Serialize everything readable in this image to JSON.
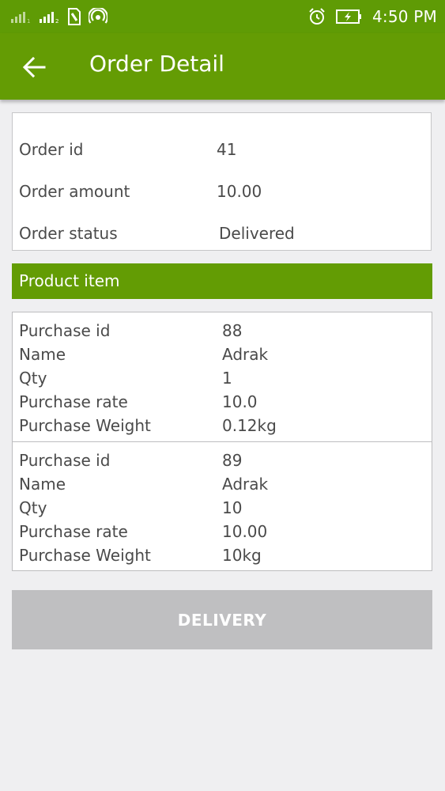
{
  "status_bar": {
    "time": "4:50 PM",
    "icons": [
      "signal-icon",
      "signal-icon-2",
      "sim-icon",
      "hotspot-icon",
      "alarm-icon",
      "battery-charging-icon"
    ]
  },
  "app_bar": {
    "title": "Order Detail",
    "back_icon": "arrow-left-icon"
  },
  "order": {
    "id_label": "Order id",
    "id_value": "41",
    "amount_label": "Order amount",
    "amount_value": "10.00",
    "status_label": "Order status",
    "status_value": "Delivered"
  },
  "products_header": "Product item",
  "products": [
    {
      "rows": [
        {
          "label": "Purchase id",
          "value": "88"
        },
        {
          "label": "Name",
          "value": "Adrak"
        },
        {
          "label": "Qty",
          "value": "1"
        },
        {
          "label": "Purchase rate",
          "value": "10.0"
        },
        {
          "label": "Purchase Weight",
          "value": "0.12kg"
        }
      ]
    },
    {
      "rows": [
        {
          "label": "Purchase id",
          "value": "89"
        },
        {
          "label": "Name",
          "value": "Adrak"
        },
        {
          "label": "Qty",
          "value": "10"
        },
        {
          "label": "Purchase rate",
          "value": "10.00"
        },
        {
          "label": "Purchase Weight",
          "value": "10kg"
        }
      ]
    }
  ],
  "delivery_button": "DELIVERY",
  "colors": {
    "primary": "#649c04",
    "status_bar": "#5f9b05",
    "background": "#efeff1",
    "button_disabled": "#bfbfc1",
    "text": "#4a4a4a"
  }
}
